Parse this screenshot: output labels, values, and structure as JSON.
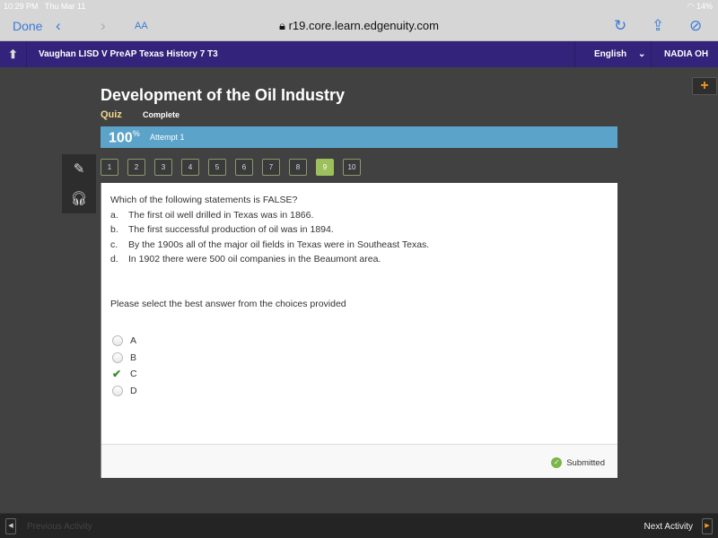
{
  "status_bar": {
    "time": "10:29 PM",
    "date": "Thu Mar 11",
    "battery": "14%"
  },
  "browser": {
    "done_label": "Done",
    "url": "r19.core.learn.edgenuity.com"
  },
  "nav": {
    "course": "Vaughan LISD V PreAP Texas History 7 T3",
    "language": "English",
    "user": "NADIA OH"
  },
  "page": {
    "title": "Development of the Oil Industry",
    "type": "Quiz",
    "status": "Complete",
    "score": "100",
    "score_unit": "%",
    "attempt": "Attempt 1"
  },
  "questions": [
    "1",
    "2",
    "3",
    "4",
    "5",
    "6",
    "7",
    "8",
    "9",
    "10"
  ],
  "active_question": "9",
  "question": {
    "text": "Which of the following statements is FALSE?",
    "options": [
      {
        "letter": "a.",
        "text": "The first oil well drilled in Texas was in 1866."
      },
      {
        "letter": "b.",
        "text": "The first successful production of oil was in 1894."
      },
      {
        "letter": "c.",
        "text": "By the 1900s all of the major oil fields in Texas were in Southeast Texas."
      },
      {
        "letter": "d.",
        "text": "In 1902 there were 500 oil companies in the Beaumont area."
      }
    ],
    "prompt": "Please select the best answer from the choices provided",
    "choices": [
      "A",
      "B",
      "C",
      "D"
    ],
    "selected": "C"
  },
  "footer": {
    "status": "Submitted"
  },
  "bottom": {
    "previous": "Previous Activity",
    "next": "Next Activity"
  },
  "colors": {
    "nav": "#33237a",
    "score_bar": "#5ba3c9",
    "active_question": "#9cc05c",
    "check": "#3a8a2a",
    "accent": "#f39a1e"
  }
}
